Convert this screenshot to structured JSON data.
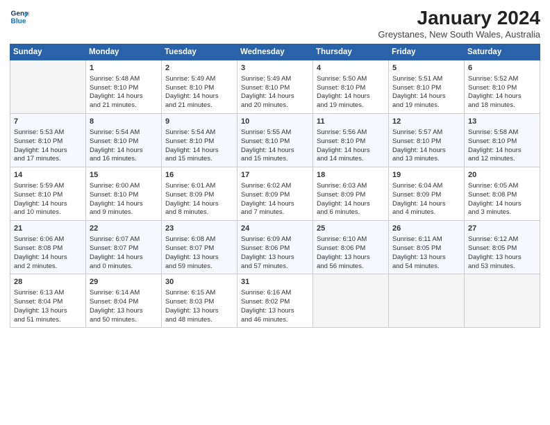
{
  "header": {
    "logo_line1": "General",
    "logo_line2": "Blue",
    "title": "January 2024",
    "location": "Greystanes, New South Wales, Australia"
  },
  "days_of_week": [
    "Sunday",
    "Monday",
    "Tuesday",
    "Wednesday",
    "Thursday",
    "Friday",
    "Saturday"
  ],
  "weeks": [
    [
      {
        "day": "",
        "info": ""
      },
      {
        "day": "1",
        "info": "Sunrise: 5:48 AM\nSunset: 8:10 PM\nDaylight: 14 hours\nand 21 minutes."
      },
      {
        "day": "2",
        "info": "Sunrise: 5:49 AM\nSunset: 8:10 PM\nDaylight: 14 hours\nand 21 minutes."
      },
      {
        "day": "3",
        "info": "Sunrise: 5:49 AM\nSunset: 8:10 PM\nDaylight: 14 hours\nand 20 minutes."
      },
      {
        "day": "4",
        "info": "Sunrise: 5:50 AM\nSunset: 8:10 PM\nDaylight: 14 hours\nand 19 minutes."
      },
      {
        "day": "5",
        "info": "Sunrise: 5:51 AM\nSunset: 8:10 PM\nDaylight: 14 hours\nand 19 minutes."
      },
      {
        "day": "6",
        "info": "Sunrise: 5:52 AM\nSunset: 8:10 PM\nDaylight: 14 hours\nand 18 minutes."
      }
    ],
    [
      {
        "day": "7",
        "info": "Sunrise: 5:53 AM\nSunset: 8:10 PM\nDaylight: 14 hours\nand 17 minutes."
      },
      {
        "day": "8",
        "info": "Sunrise: 5:54 AM\nSunset: 8:10 PM\nDaylight: 14 hours\nand 16 minutes."
      },
      {
        "day": "9",
        "info": "Sunrise: 5:54 AM\nSunset: 8:10 PM\nDaylight: 14 hours\nand 15 minutes."
      },
      {
        "day": "10",
        "info": "Sunrise: 5:55 AM\nSunset: 8:10 PM\nDaylight: 14 hours\nand 15 minutes."
      },
      {
        "day": "11",
        "info": "Sunrise: 5:56 AM\nSunset: 8:10 PM\nDaylight: 14 hours\nand 14 minutes."
      },
      {
        "day": "12",
        "info": "Sunrise: 5:57 AM\nSunset: 8:10 PM\nDaylight: 14 hours\nand 13 minutes."
      },
      {
        "day": "13",
        "info": "Sunrise: 5:58 AM\nSunset: 8:10 PM\nDaylight: 14 hours\nand 12 minutes."
      }
    ],
    [
      {
        "day": "14",
        "info": "Sunrise: 5:59 AM\nSunset: 8:10 PM\nDaylight: 14 hours\nand 10 minutes."
      },
      {
        "day": "15",
        "info": "Sunrise: 6:00 AM\nSunset: 8:10 PM\nDaylight: 14 hours\nand 9 minutes."
      },
      {
        "day": "16",
        "info": "Sunrise: 6:01 AM\nSunset: 8:09 PM\nDaylight: 14 hours\nand 8 minutes."
      },
      {
        "day": "17",
        "info": "Sunrise: 6:02 AM\nSunset: 8:09 PM\nDaylight: 14 hours\nand 7 minutes."
      },
      {
        "day": "18",
        "info": "Sunrise: 6:03 AM\nSunset: 8:09 PM\nDaylight: 14 hours\nand 6 minutes."
      },
      {
        "day": "19",
        "info": "Sunrise: 6:04 AM\nSunset: 8:09 PM\nDaylight: 14 hours\nand 4 minutes."
      },
      {
        "day": "20",
        "info": "Sunrise: 6:05 AM\nSunset: 8:08 PM\nDaylight: 14 hours\nand 3 minutes."
      }
    ],
    [
      {
        "day": "21",
        "info": "Sunrise: 6:06 AM\nSunset: 8:08 PM\nDaylight: 14 hours\nand 2 minutes."
      },
      {
        "day": "22",
        "info": "Sunrise: 6:07 AM\nSunset: 8:07 PM\nDaylight: 14 hours\nand 0 minutes."
      },
      {
        "day": "23",
        "info": "Sunrise: 6:08 AM\nSunset: 8:07 PM\nDaylight: 13 hours\nand 59 minutes."
      },
      {
        "day": "24",
        "info": "Sunrise: 6:09 AM\nSunset: 8:06 PM\nDaylight: 13 hours\nand 57 minutes."
      },
      {
        "day": "25",
        "info": "Sunrise: 6:10 AM\nSunset: 8:06 PM\nDaylight: 13 hours\nand 56 minutes."
      },
      {
        "day": "26",
        "info": "Sunrise: 6:11 AM\nSunset: 8:05 PM\nDaylight: 13 hours\nand 54 minutes."
      },
      {
        "day": "27",
        "info": "Sunrise: 6:12 AM\nSunset: 8:05 PM\nDaylight: 13 hours\nand 53 minutes."
      }
    ],
    [
      {
        "day": "28",
        "info": "Sunrise: 6:13 AM\nSunset: 8:04 PM\nDaylight: 13 hours\nand 51 minutes."
      },
      {
        "day": "29",
        "info": "Sunrise: 6:14 AM\nSunset: 8:04 PM\nDaylight: 13 hours\nand 50 minutes."
      },
      {
        "day": "30",
        "info": "Sunrise: 6:15 AM\nSunset: 8:03 PM\nDaylight: 13 hours\nand 48 minutes."
      },
      {
        "day": "31",
        "info": "Sunrise: 6:16 AM\nSunset: 8:02 PM\nDaylight: 13 hours\nand 46 minutes."
      },
      {
        "day": "",
        "info": ""
      },
      {
        "day": "",
        "info": ""
      },
      {
        "day": "",
        "info": ""
      }
    ]
  ]
}
